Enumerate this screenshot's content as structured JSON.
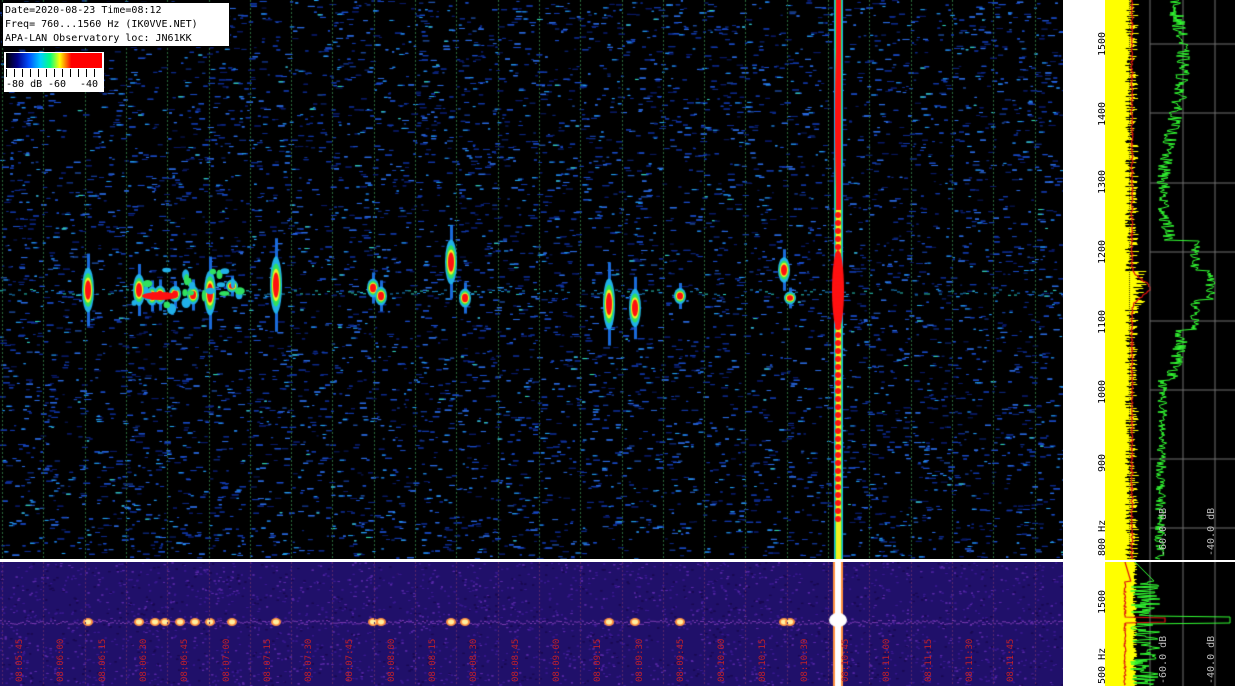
{
  "info": {
    "line1": "Date=2020-08-23 Time=08:12",
    "line2": "Freq= 760...1560 Hz (IK0VVE.NET)",
    "line3": "APA-LAN Observatory loc: JN61KK"
  },
  "colorbar": {
    "label_min": "-80 dB",
    "label_mid": "-60",
    "label_max": "-40"
  },
  "freq_axis": {
    "labels": [
      "1500",
      "1400",
      "1300",
      "1200",
      "1100",
      "1000",
      "900",
      "800 Hz"
    ]
  },
  "lower_freq_axis": {
    "labels": [
      "1500",
      "500 Hz"
    ]
  },
  "db_labels": {
    "a": "-60.0 dB",
    "b": "-40.0 dB"
  },
  "time_axis": {
    "labels": [
      "08:05:45",
      "08:06:00",
      "08:06:15",
      "08:06:30",
      "08:06:45",
      "08:07:00",
      "08:07:15",
      "08:07:30",
      "08:07:45",
      "08:08:00",
      "08:08:15",
      "08:08:30",
      "08:08:45",
      "08:09:00",
      "08:09:15",
      "08:09:30",
      "08:09:45",
      "08:10:00",
      "08:10:15",
      "08:10:30",
      "08:10:45",
      "08:11:00",
      "08:11:15",
      "08:11:30",
      "08:11:45"
    ]
  },
  "colors": {
    "signal_red": "#ff1010",
    "spectrum_yellow": "#ffff00",
    "spectrum_green": "#33ff33",
    "time_label": "#c0202a"
  }
}
